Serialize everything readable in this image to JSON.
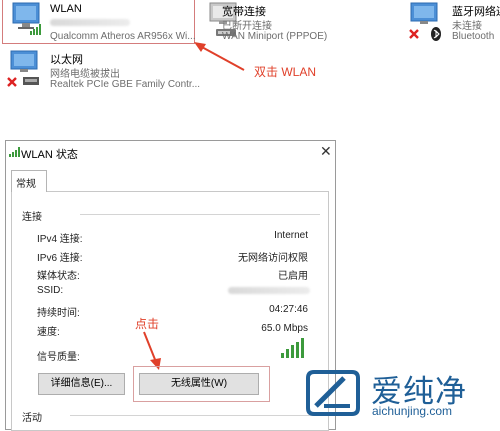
{
  "connections": [
    {
      "name": "WLAN",
      "status": "",
      "device": "Qualcomm Atheros AR956x Wi..."
    },
    {
      "name": "宽带连接",
      "status": "已断开连接",
      "device": "WAN Miniport (PPPOE)"
    },
    {
      "name": "蓝牙网络连",
      "status": "未连接",
      "device": "Bluetooth"
    },
    {
      "name": "以太网",
      "status": "网络电缆被拔出",
      "device": "Realtek PCIe GBE Family Contr..."
    }
  ],
  "annotations": {
    "double_click": "双击 WLAN",
    "click": "点击"
  },
  "dialog": {
    "title": "WLAN 状态",
    "tab": "常规",
    "connection_group": "连接",
    "activity_group": "活动",
    "rows": [
      {
        "label": "IPv4 连接:",
        "value": "Internet"
      },
      {
        "label": "IPv6 连接:",
        "value": "无网络访问权限"
      },
      {
        "label": "媒体状态:",
        "value": "已启用"
      },
      {
        "label": "SSID:",
        "value": ""
      },
      {
        "label": "持续时间:",
        "value": "04:27:46"
      },
      {
        "label": "速度:",
        "value": "65.0 Mbps"
      }
    ],
    "signal_label": "信号质量:",
    "signal_level": 1.0,
    "details_button": "详细信息(E)...",
    "wireless_props_button": "无线属性(W)"
  },
  "watermark": {
    "text": "爱纯净",
    "url": "aichunjing.com"
  },
  "colors": {
    "annotation": "#e0402a",
    "watermark": "#1f5f97",
    "signal": "#3c9a3c"
  }
}
